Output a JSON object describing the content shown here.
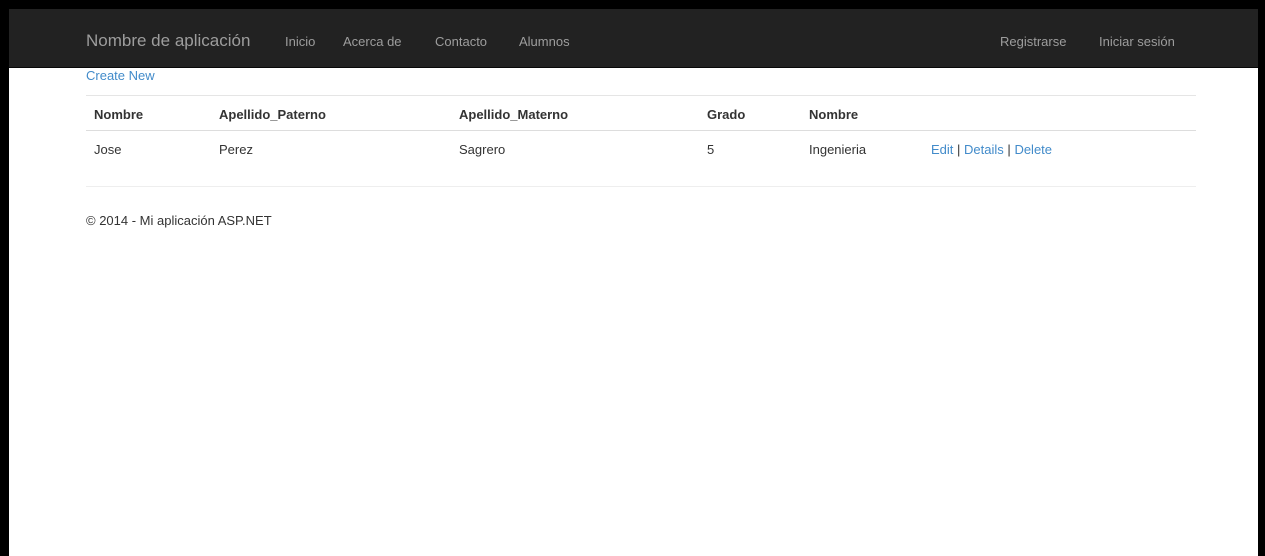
{
  "navbar": {
    "brand": "Nombre de aplicación",
    "links": [
      "Inicio",
      "Acerca de",
      "Contacto",
      "Alumnos"
    ],
    "right_links": [
      "Registrarse",
      "Iniciar sesión"
    ]
  },
  "content": {
    "create_link": "Create New",
    "table": {
      "headers": [
        "Nombre",
        "Apellido_Paterno",
        "Apellido_Materno",
        "Grado",
        "Nombre"
      ],
      "rows": [
        {
          "cells": [
            "Jose",
            "Perez",
            "Sagrero",
            "5",
            "Ingenieria"
          ],
          "actions": {
            "edit": "Edit",
            "separator": "|",
            "details": "Details",
            "delete": "Delete"
          }
        }
      ]
    }
  },
  "footer": {
    "text": "© 2014 - Mi aplicación ASP.NET"
  },
  "colors": {
    "navbar_bg": "#222222",
    "nav_text": "#9d9d9d",
    "link": "#428bca"
  }
}
